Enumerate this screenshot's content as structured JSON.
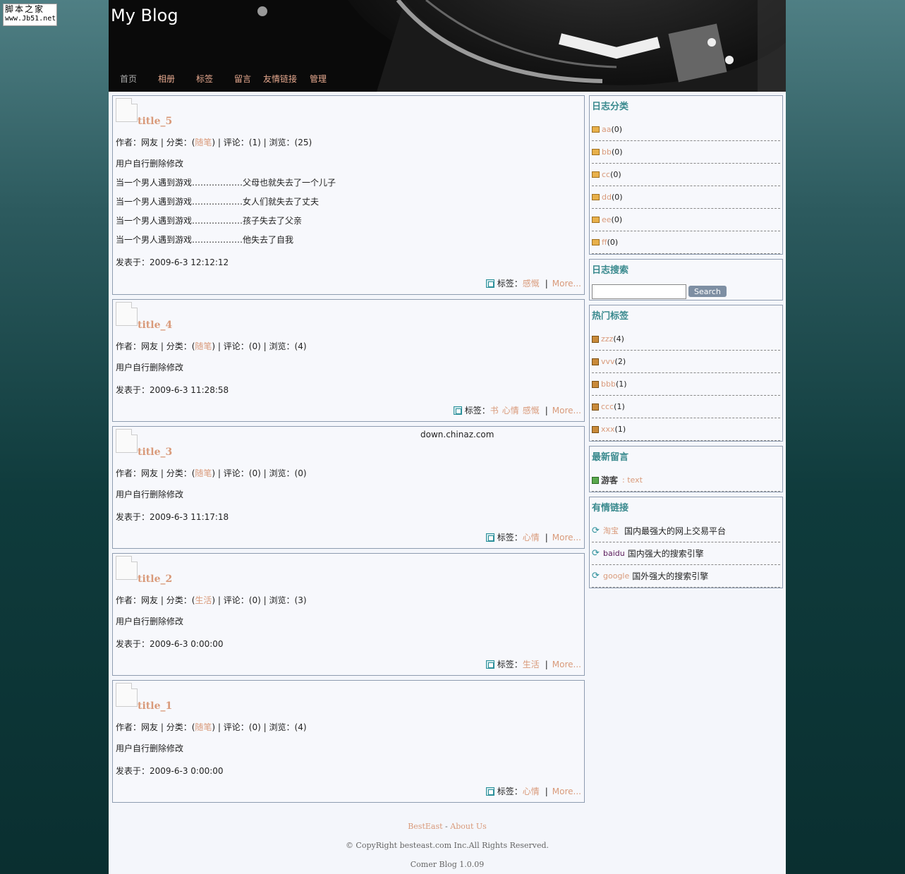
{
  "watermark": {
    "line1": "脚本之家",
    "line2": "www.Jb51.net"
  },
  "header": {
    "title": "My Blog"
  },
  "nav": [
    "首页",
    "相册",
    "标签",
    "留言",
    "友情链接",
    "管理"
  ],
  "posts": [
    {
      "title": "title_5",
      "author": "网友",
      "category": "随笔",
      "comments": "1",
      "views": "25",
      "lines": [
        "用户自行删除修改",
        "当一个男人遇到游戏………………父母也就失去了一个儿子",
        "当一个男人遇到游戏………………女人们就失去了丈夫",
        "当一个男人遇到游戏………………孩子失去了父亲",
        "当一个男人遇到游戏………………他失去了自我"
      ],
      "date": "2009-6-3 12:12:12",
      "tags": [
        "感慨"
      ]
    },
    {
      "title": "title_4",
      "author": "网友",
      "category": "随笔",
      "comments": "0",
      "views": "4",
      "lines": [
        "用户自行删除修改"
      ],
      "date": "2009-6-3 11:28:58",
      "tags": [
        "书",
        "心情",
        "感慨"
      ]
    },
    {
      "title": "title_3",
      "author": "网友",
      "category": "随笔",
      "comments": "0",
      "views": "0",
      "lines": [
        "用户自行删除修改"
      ],
      "date": "2009-6-3 11:17:18",
      "tags": [
        "心情"
      ]
    },
    {
      "title": "title_2",
      "author": "网友",
      "category": "生活",
      "comments": "0",
      "views": "3",
      "lines": [
        "用户自行删除修改"
      ],
      "date": "2009-6-3 0:00:00",
      "tags": [
        "生活"
      ]
    },
    {
      "title": "title_1",
      "author": "网友",
      "category": "随笔",
      "comments": "0",
      "views": "4",
      "lines": [
        "用户自行删除修改"
      ],
      "date": "2009-6-3 0:00:00",
      "tags": [
        "心情"
      ]
    }
  ],
  "labels": {
    "author": "作者：",
    "category": "分类：",
    "comments": "评论：",
    "views": "浏览：",
    "posted": "发表于：",
    "tags": "标签：",
    "more": "More..."
  },
  "chinaz": "down.chinaz.com",
  "sidebar": {
    "categories": {
      "title": "日志分类",
      "items": [
        {
          "name": "aa",
          "count": "(0)"
        },
        {
          "name": "bb",
          "count": "(0)"
        },
        {
          "name": "cc",
          "count": "(0)"
        },
        {
          "name": "dd",
          "count": "(0)"
        },
        {
          "name": "ee",
          "count": "(0)"
        },
        {
          "name": "ff",
          "count": "(0)"
        }
      ]
    },
    "search": {
      "title": "日志搜索",
      "button": "Search",
      "value": ""
    },
    "hot_tags": {
      "title": "热门标签",
      "items": [
        {
          "name": "zzz",
          "count": "(4)"
        },
        {
          "name": "vvv",
          "count": "(2)"
        },
        {
          "name": "bbb",
          "count": "(1)"
        },
        {
          "name": "ccc",
          "count": "(1)"
        },
        {
          "name": "xxx",
          "count": "(1)"
        }
      ]
    },
    "messages": {
      "title": "最新留言",
      "items": [
        {
          "user": "游客",
          "text": ": text"
        }
      ]
    },
    "links": {
      "title": "有情链接",
      "items": [
        {
          "name": "淘宝",
          "desc": "国内最强大的网上交易平台"
        },
        {
          "name": "baidu",
          "desc": "国内强大的搜索引擎"
        },
        {
          "name": "google",
          "desc": "国外强大的搜索引擎"
        }
      ]
    }
  },
  "footer": {
    "links": [
      "BestEast",
      "About Us"
    ],
    "copyright": "© CopyRight besteast.com Inc.All Rights Reserved.",
    "version": "Comer Blog 1.0.09"
  },
  "colors": {
    "accent": "#d99a7a",
    "heading": "#3a8a8e",
    "border": "#8e9cb0",
    "page_bg": "#f4f6fb"
  }
}
